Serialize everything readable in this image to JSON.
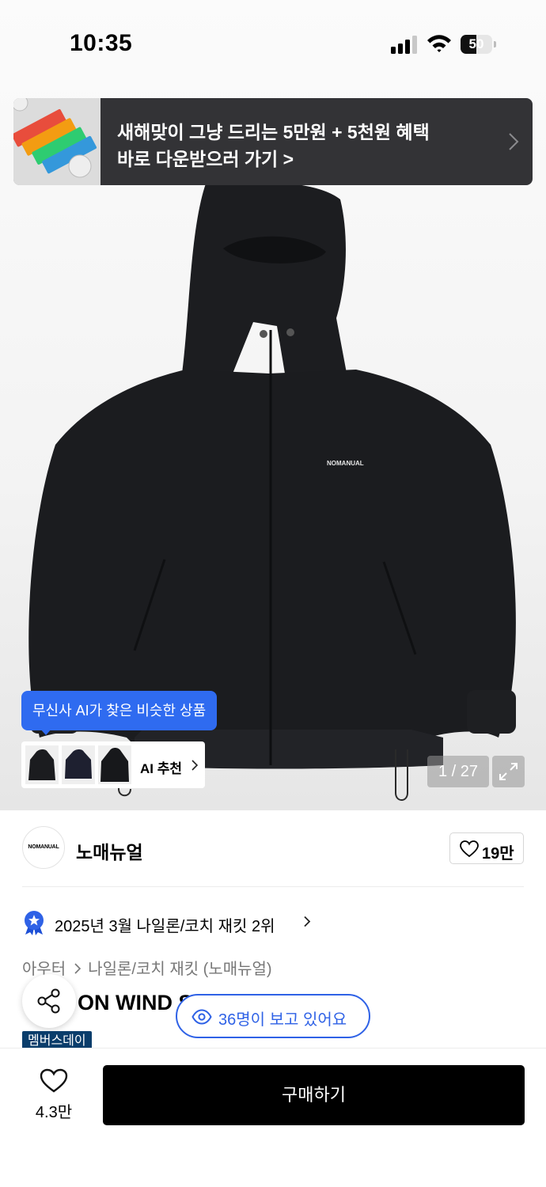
{
  "status_bar": {
    "time": "10:35",
    "battery_level": "50",
    "icons": [
      "cellular-signal-icon",
      "wifi-icon",
      "battery-icon"
    ]
  },
  "promo_banner": {
    "line1": "새해맞이 그냥 드리는 5만원 + 5천원 혜택",
    "line2": "바로 다운받으러 가기 >",
    "background_color": "#333336"
  },
  "product_image": {
    "logo_text": "NOMANUAL",
    "counter": "1 / 27",
    "icons": [
      "expand-icon"
    ]
  },
  "ai_recommend": {
    "bubble_text": "무신사 AI가 찾은 비슷한 상품",
    "label": "AI 추천",
    "accent_color": "#2f6bf0"
  },
  "brand": {
    "logo_text": "NOMANUAL",
    "name": "노매뉴얼",
    "like_count": "19만"
  },
  "ranking": {
    "text": "2025년 3월 나일론/코치 재킷 2위"
  },
  "breadcrumb": {
    "items": [
      "아우터",
      "나일론/코치 재킷 (노매뉴얼)"
    ]
  },
  "product": {
    "title_visible": "ON WIND S",
    "viewers_text": "36명이 보고 있어요",
    "badge": "멤버스데이",
    "badge_color": "#0a3d6b"
  },
  "bottom_bar": {
    "wish_count": "4.3만",
    "buy_label": "구매하기"
  }
}
